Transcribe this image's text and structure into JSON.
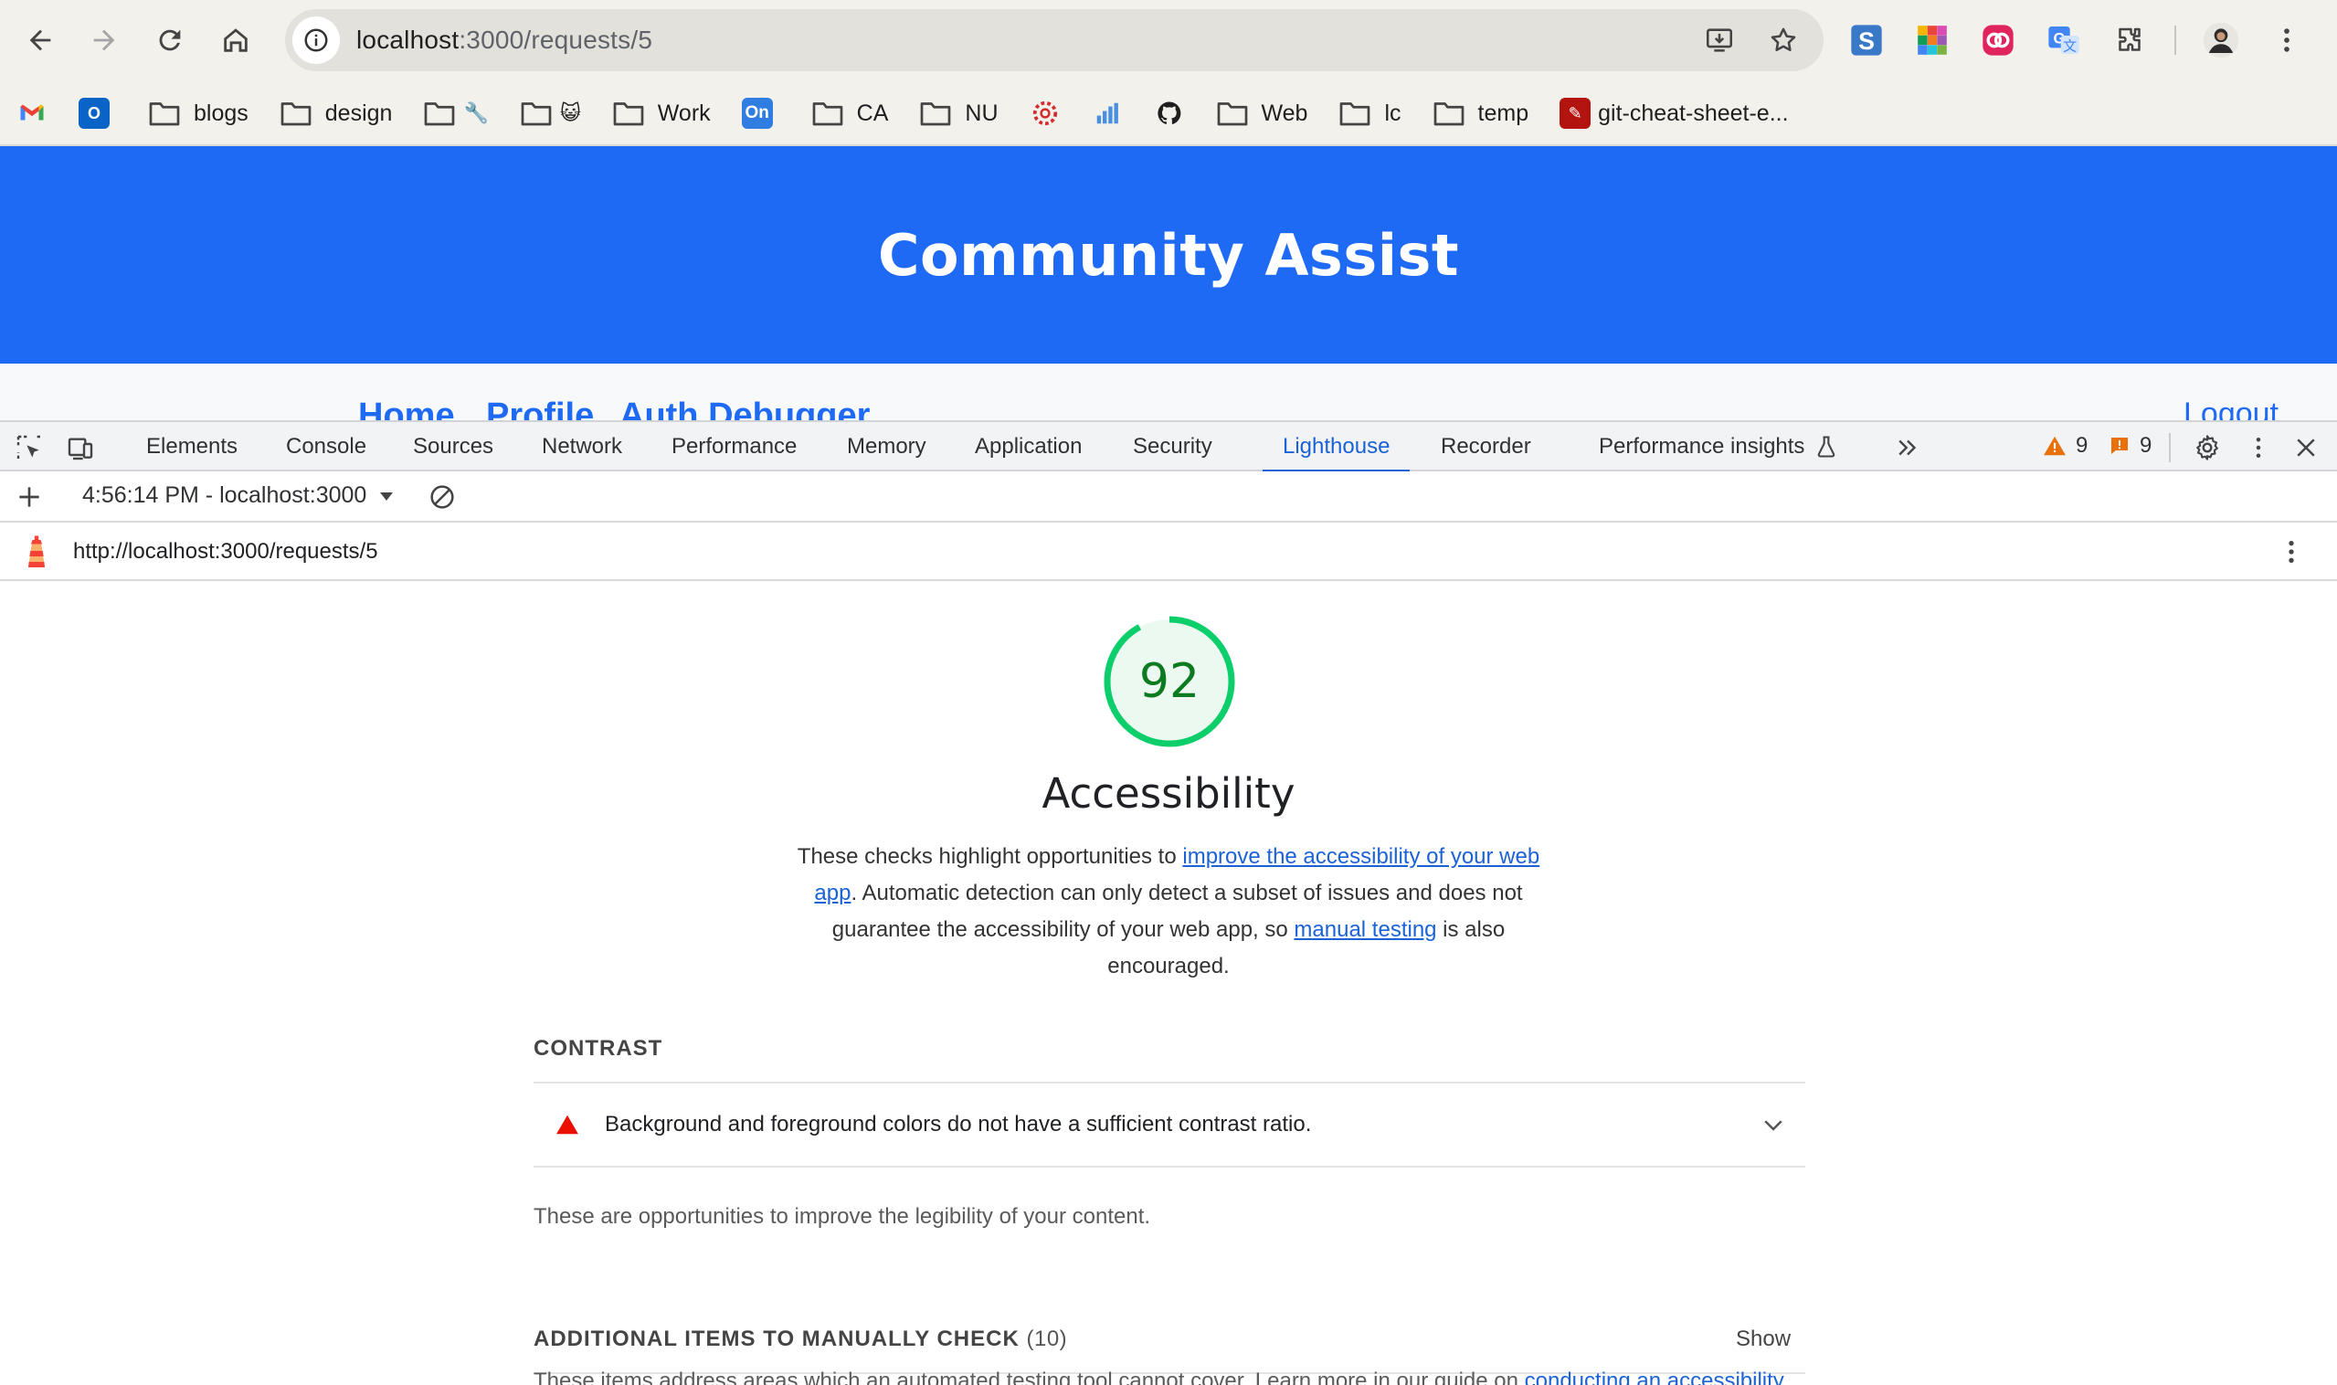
{
  "browser": {
    "url_host": "localhost",
    "url_path": ":3000/requests/5",
    "bookmarks": [
      {
        "label": "blogs",
        "type": "folder"
      },
      {
        "label": "design",
        "type": "folder"
      },
      {
        "label": "",
        "type": "folder",
        "emoji": "🔧"
      },
      {
        "label": "",
        "type": "folder",
        "emoji": "😺"
      },
      {
        "label": "Work",
        "type": "folder"
      },
      {
        "label": "On",
        "type": "app"
      },
      {
        "label": "CA",
        "type": "folder"
      },
      {
        "label": "NU",
        "type": "folder"
      },
      {
        "label": "Web",
        "type": "folder"
      },
      {
        "label": "lc",
        "type": "folder"
      },
      {
        "label": "temp",
        "type": "folder"
      },
      {
        "label": "git-cheat-sheet-e...",
        "type": "pdf"
      }
    ]
  },
  "page": {
    "title": "Community Assist",
    "nav": {
      "home": "Home",
      "profile": "Profile",
      "auth_debugger": "Auth Debugger",
      "logout": "Logout"
    }
  },
  "devtools": {
    "tabs": [
      "Elements",
      "Console",
      "Sources",
      "Network",
      "Performance",
      "Memory",
      "Application",
      "Security",
      "Lighthouse",
      "Recorder",
      "Performance insights"
    ],
    "active_tab": "Lighthouse",
    "warnings_count": "9",
    "issues_count": "9",
    "report_select": "4:56:14 PM - localhost:3000",
    "report_url": "http://localhost:3000/requests/5"
  },
  "report": {
    "score": 92,
    "score_display": "92",
    "category_title": "Accessibility",
    "desc_part1": "These checks highlight opportunities to ",
    "desc_link1": "improve the accessibility of your web app",
    "desc_part2": ". Automatic detection can only detect a subset of issues and does not guarantee the accessibility of your web app, so ",
    "desc_link2": "manual testing",
    "desc_part3": " is also encouraged.",
    "contrast_group_title": "CONTRAST",
    "contrast_audit": "Background and foreground colors do not have a sufficient contrast ratio.",
    "contrast_group_desc": "These are opportunities to improve the legibility of your content.",
    "manual_group_title": "ADDITIONAL ITEMS TO MANUALLY CHECK",
    "manual_group_count": "(10)",
    "manual_show": "Show",
    "manual_desc_text": "These items address areas which an automated testing tool cannot cover. Learn more in our guide on ",
    "manual_desc_link": "conducting an accessibility"
  },
  "colors": {
    "page_header": "#1f6af5",
    "score_green": "#0c7a21",
    "gauge_ring": "#0cce6b",
    "link": "#1a62d6",
    "fail_red": "#eb0f00"
  }
}
